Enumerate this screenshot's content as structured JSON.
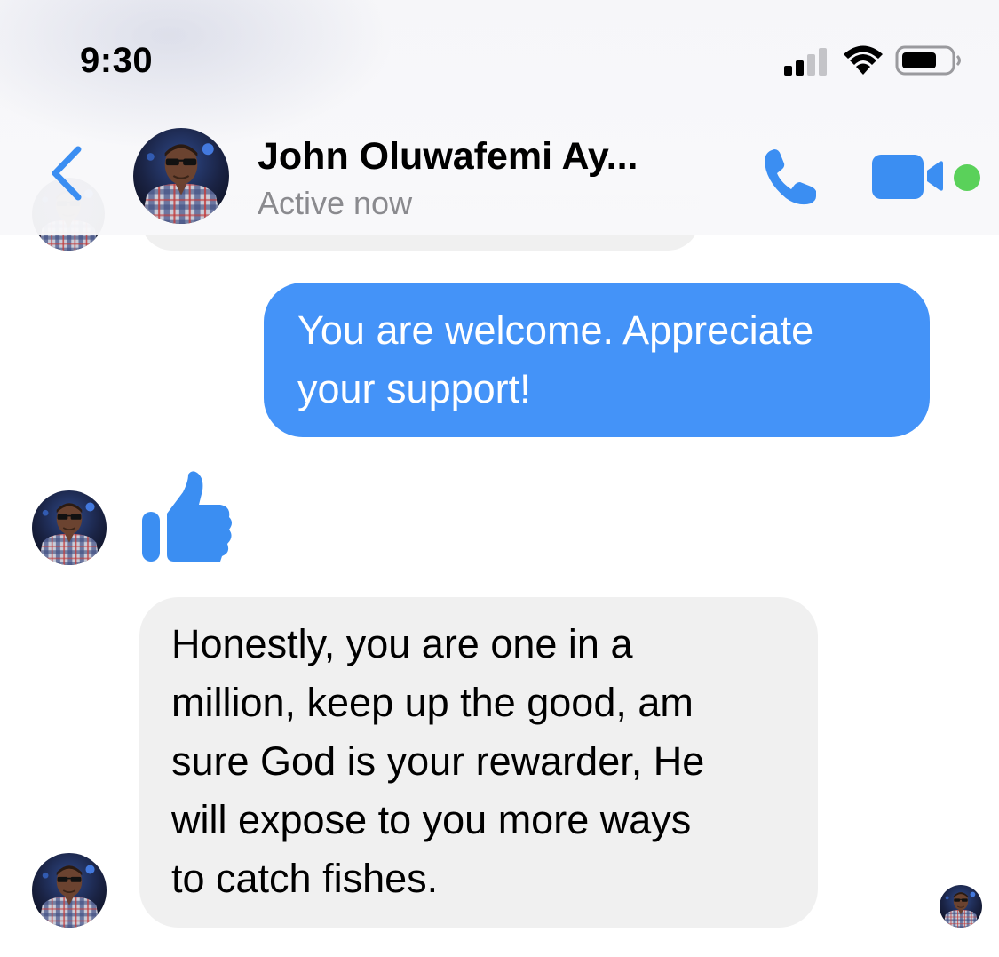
{
  "status_bar": {
    "time": "9:30",
    "signal_icon": "cellular-signal-icon",
    "wifi_icon": "wifi-icon",
    "battery_icon": "battery-icon"
  },
  "header": {
    "back_icon": "chevron-left-icon",
    "contact_name": "John Oluwafemi Ay...",
    "contact_status": "Active now",
    "call_icon": "phone-icon",
    "video_icon": "video-camera-icon",
    "accent_color": "#3b8ef2",
    "online_color": "#5ad15a"
  },
  "messages": [
    {
      "direction": "outgoing",
      "type": "text",
      "lines": [
        "You are welcome. Appreciate",
        "your support!"
      ],
      "bubble_color": "#4493f8"
    },
    {
      "direction": "incoming",
      "type": "like",
      "icon": "thumbs-up-icon"
    },
    {
      "direction": "incoming",
      "type": "text",
      "lines": [
        "Honestly, you are one in a",
        "million, keep up the good, am",
        "sure God is your rewarder, He",
        "will expose to you more ways",
        "to catch fishes."
      ],
      "bubble_color": "#f0f0f0"
    }
  ]
}
